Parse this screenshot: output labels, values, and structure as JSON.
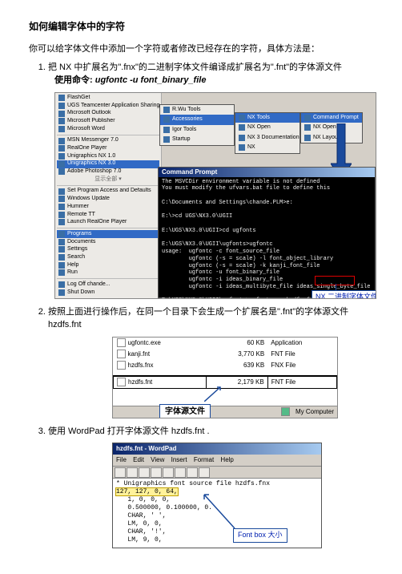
{
  "title": "如何编辑字体中的字符",
  "intro": "你可以给字体文件中添加一个字符或者修改已经存在的字符，具体方法是：",
  "steps": {
    "s1": {
      "text_full": "把 NX 中扩展名为\".fnx\"的二进制字体文件编译成扩展名为\".fnt\"的字体源文件",
      "cmd_label": "使用命令: ",
      "cmd": "ugfontc -u font_binary_file"
    },
    "s2": "按照上面进行操作后，在同一个目录下会生成一个扩展名是\".fnt\"的字体源文件 hzdfs.fnt",
    "s3": "使用 WordPad 打开字体源文件 hzdfs.fnt ."
  },
  "startmenu": {
    "items": [
      "FlashGet",
      "UGS Teamcenter Application Sharing",
      "Microsoft Outlook",
      "Microsoft Publisher",
      "Microsoft Word"
    ],
    "mid": [
      "MSN Messenger 7.0",
      "RealOne Player",
      "Unigraphics NX 1.0",
      "Adobe Photoshop 7.0"
    ],
    "bot": [
      "Set Program Access and Defaults",
      "Windows Update",
      "Hummer",
      "Remote TT",
      "Launch RealOne Player"
    ],
    "sections": [
      "Programs",
      "Documents",
      "Settings",
      "Search",
      "Help",
      "Run",
      "Log Off chande...",
      "Shut Down"
    ],
    "submenu1": [
      "R.Wu Tools",
      "Accessories",
      "Igor Tools",
      "Startup"
    ],
    "submenu2": [
      "NX Tools",
      "NX Open",
      "NX 3 Documentation",
      "NX"
    ],
    "submenu3": [
      "Command Prompt",
      "NX Open",
      "NX Layout"
    ],
    "hl1": "Unigraphics NX 3.0",
    "hl2": "Accessories",
    "hl3": "NX Tools",
    "hl4": "Command Prompt",
    "collapse": "显示全部 ▾"
  },
  "cmdwin": {
    "title": "Command Prompt",
    "lines": "The MSVCDir environment variable is not defined\nYou must modify the ufvars.bat file to define this\n\nC:\\Documents and Settings\\chande.PLM>e:\n\nE:\\>cd UGS\\NX3.0\\UGII\n\nE:\\UGS\\NX3.0\\UGII>cd ugfonts\n\nE:\\UGS\\NX3.0\\UGII\\ugfonts>ugfontc\nusage:  ugfontc -c font_source_file\n        ugfontc (-s = scale) -l font_object_library\n        ugfontc (-s = scale) -k kanji_font_file\n        ugfontc -u font_binary_file\n        ugfontc -i ideas_binary_file\n        ugfontc -i ideas_multibyte_file ideas_single_byte_file\n\nE:\\UGS\\NX3.0\\UGII\\ugfonts>ugfontc -u hzdfs.fnx\n\nE:\\UGS\\NX3.0\\UGII\\ugfonts>"
  },
  "callout1": "NX 二进制字体文件",
  "files": {
    "rows": [
      {
        "name": "ugfontc.exe",
        "size": "60 KB",
        "type": "Application"
      },
      {
        "name": "kanji.fnt",
        "size": "3,770 KB",
        "type": "FNT File"
      },
      {
        "name": "hzdfs.fnx",
        "size": "639 KB",
        "type": "FNX File"
      },
      {
        "name": "hzdfs.fnt",
        "size": "2,179 KB",
        "type": "FNT File"
      }
    ],
    "footer": "My Computer"
  },
  "callout2": "字体源文件",
  "wordpad": {
    "title": "hzdfs.fnt - WordPad",
    "menus": [
      "File",
      "Edit",
      "View",
      "Insert",
      "Format",
      "Help"
    ],
    "content_line1": "* Unigraphics font source file hzdfs.fnx",
    "highlight": "127, 127, 0, 64,",
    "rest": "   1, 0, 0, 0,\n   0.500000, 0.100000, 0.\n   CHAR, ' ',\n   LM, 0, 0,\n   CHAR, '!',\n   LM, 9, 0,"
  },
  "callout3": "Font box 大小"
}
